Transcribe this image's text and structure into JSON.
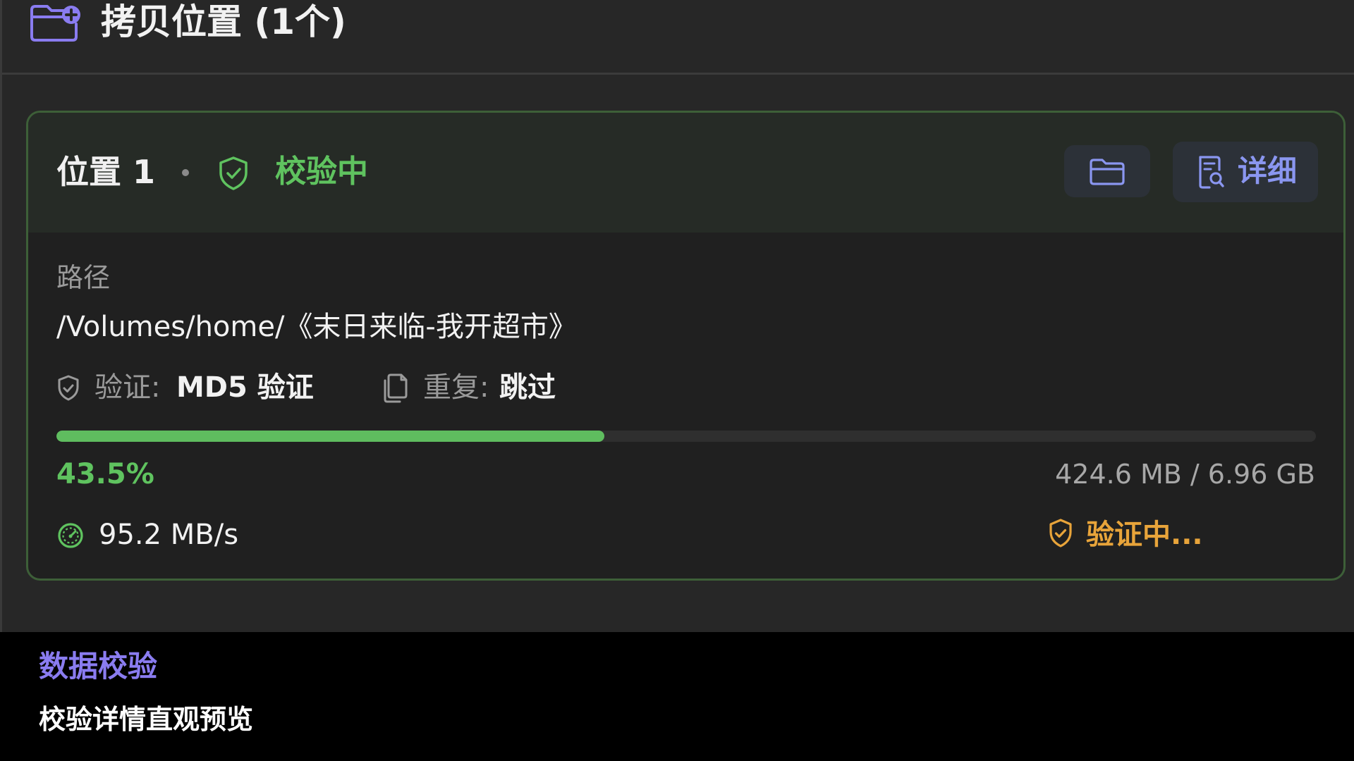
{
  "section": {
    "icon": "folder-plus-icon",
    "title": "拷贝位置 (1个)"
  },
  "location": {
    "title": "位置 1",
    "status_icon": "shield-check-icon",
    "status_label": "校验中",
    "open_folder_icon": "folder-icon",
    "detail_icon": "document-search-icon",
    "detail_label": "详细",
    "path_caption": "路径",
    "path_value": "/Volumes/home/《末日来临-我开超市》",
    "verify_label": "验证:",
    "verify_value": "MD5 验证",
    "duplicate_label": "重复:",
    "duplicate_value": "跳过",
    "progress_fraction": 0.435,
    "progress_percent": "43.5%",
    "progress_size": "424.6 MB / 6.96 GB",
    "speed_icon": "speedometer-icon",
    "speed": "95.2 MB/s",
    "verify_status_icon": "shield-check-icon",
    "verify_status": "验证中..."
  },
  "caption": {
    "title": "数据校验",
    "subtitle": "校验详情直观预览"
  },
  "colors": {
    "accent_purple": "#8a7cf0",
    "success_green": "#5fc35f",
    "warning_orange": "#e8a43a",
    "panel_bg": "#272727",
    "card_border": "#3d5f38"
  }
}
